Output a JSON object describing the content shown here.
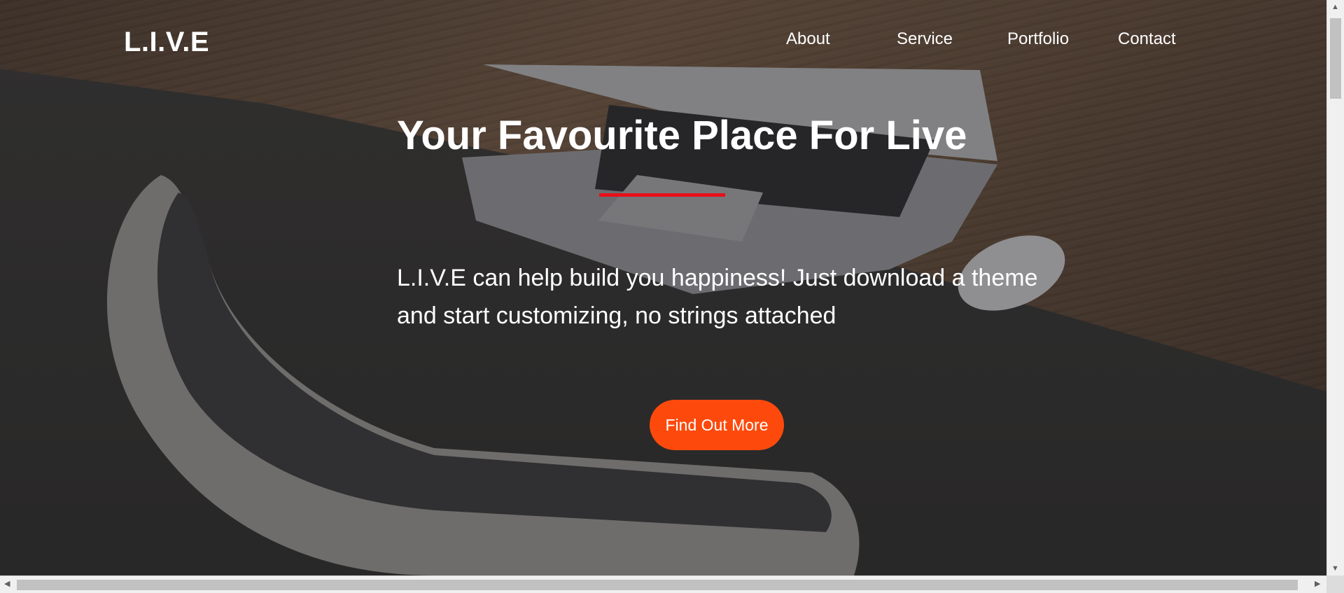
{
  "brand": {
    "name": "L.I.V.E"
  },
  "nav": {
    "items": [
      {
        "label": "About"
      },
      {
        "label": "Service"
      },
      {
        "label": "Portfolio"
      },
      {
        "label": "Contact"
      }
    ]
  },
  "hero": {
    "title": "Your Favourite Place For Live",
    "text": "L.I.V.E can help build you happiness! Just download a theme and start customizing, no strings attached",
    "cta_label": "Find Out More"
  },
  "colors": {
    "accent_divider": "#e8101a",
    "cta_background": "#fd4a0c",
    "text": "#ffffff"
  },
  "scrollbars": {
    "vertical_arrows": [
      "up-arrow-icon",
      "down-arrow-icon"
    ],
    "horizontal_arrows": [
      "left-arrow-icon",
      "right-arrow-icon"
    ]
  }
}
